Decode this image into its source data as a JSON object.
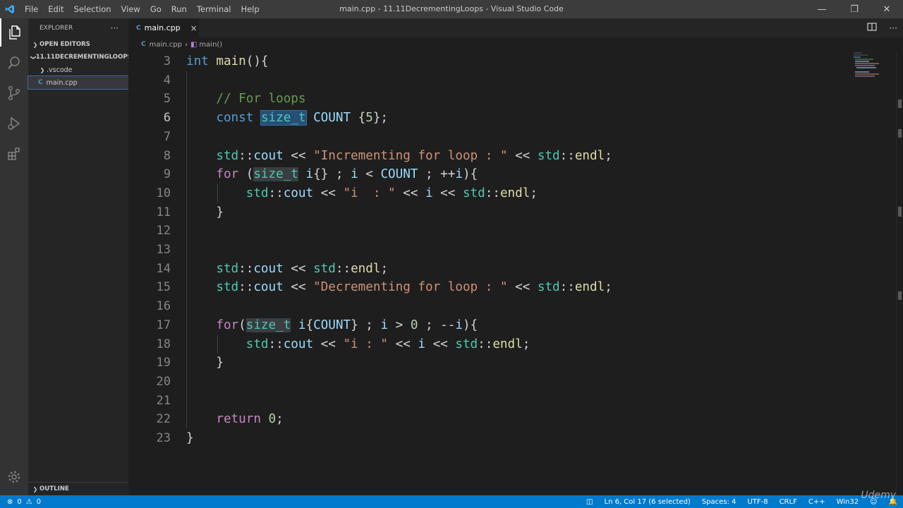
{
  "window": {
    "title": "main.cpp - 11.11DecrementingLoops - Visual Studio Code",
    "menu": [
      "File",
      "Edit",
      "Selection",
      "View",
      "Go",
      "Run",
      "Terminal",
      "Help"
    ]
  },
  "sidebar": {
    "header": "EXPLORER",
    "more": "···",
    "open_editors": "OPEN EDITORS",
    "folder": "11.11DECREMENTINGLOOPS",
    "items": [
      {
        "label": ".vscode"
      },
      {
        "label": "main.cpp"
      }
    ],
    "outline": "OUTLINE"
  },
  "tabs": [
    {
      "label": "main.cpp",
      "icon": "C",
      "close": "×"
    }
  ],
  "breadcrumb": {
    "file": "main.cpp",
    "symbol": "main()",
    "file_icon": "C"
  },
  "editor": {
    "line_numbers": [
      "3",
      "4",
      "5",
      "6",
      "7",
      "8",
      "9",
      "10",
      "11",
      "12",
      "13",
      "14",
      "15",
      "16",
      "17",
      "18",
      "19",
      "20",
      "21",
      "22",
      "23"
    ],
    "current_line": "6"
  },
  "status": {
    "errors": "0",
    "warnings": "0",
    "position": "Ln 6, Col 17 (6 selected)",
    "spaces": "Spaces: 4",
    "encoding": "UTF-8",
    "eol": "CRLF",
    "language": "C++",
    "platform": "Win32"
  },
  "watermark": "Udemy",
  "colors": {
    "accent": "#007acc",
    "keyword": "#569cd6",
    "type": "#4ec9b0",
    "string": "#ce9178",
    "comment": "#6a9955",
    "number": "#b5cea8"
  }
}
